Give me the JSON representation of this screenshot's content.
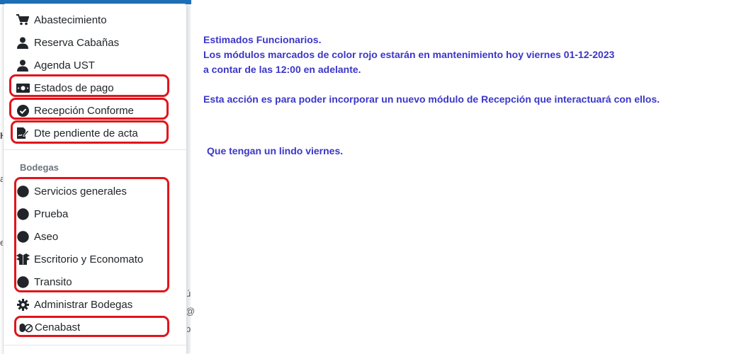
{
  "menu": {
    "items_top": [
      {
        "label": "Abastecimiento",
        "icon": "cart-icon"
      },
      {
        "label": "Reserva Cabañas",
        "icon": "user-icon"
      },
      {
        "label": "Agenda UST",
        "icon": "user-icon"
      },
      {
        "label": "Estados de pago",
        "icon": "money-bill-icon"
      },
      {
        "label": "Recepción Conforme",
        "icon": "check-circle-icon"
      },
      {
        "label": "Dte pendiente de acta",
        "icon": "file-signature-icon"
      }
    ],
    "section_header": "Bodegas",
    "items_bodegas": [
      {
        "label": "Servicios generales",
        "icon": "circle-icon"
      },
      {
        "label": "Prueba",
        "icon": "circle-icon"
      },
      {
        "label": "Aseo",
        "icon": "circle-icon"
      },
      {
        "label": "Escritorio y Economato",
        "icon": "box-open-icon"
      },
      {
        "label": "Transito",
        "icon": "circle-icon"
      },
      {
        "label": "Administrar Bodegas",
        "icon": "gear-icon"
      },
      {
        "label": "Cenabast",
        "icon": "pills-icon"
      }
    ],
    "highlight_color": "#e0151b"
  },
  "notice": {
    "line1": "Estimados Funcionarios.",
    "line2": "Los módulos marcados de color rojo estarán en mantenimiento hoy viernes 01-12-2023",
    "line3": "a contar de las 12:00 en adelante.",
    "line4": "Esta acción es para poder incorporar un nuevo módulo de Recepción que interactuará con ellos.",
    "line5": "Que tengan un lindo viernes.",
    "color": "#3b36c9"
  },
  "background_fragments": [
    "H",
    "a",
    "el",
    "ú",
    "@",
    "b"
  ]
}
